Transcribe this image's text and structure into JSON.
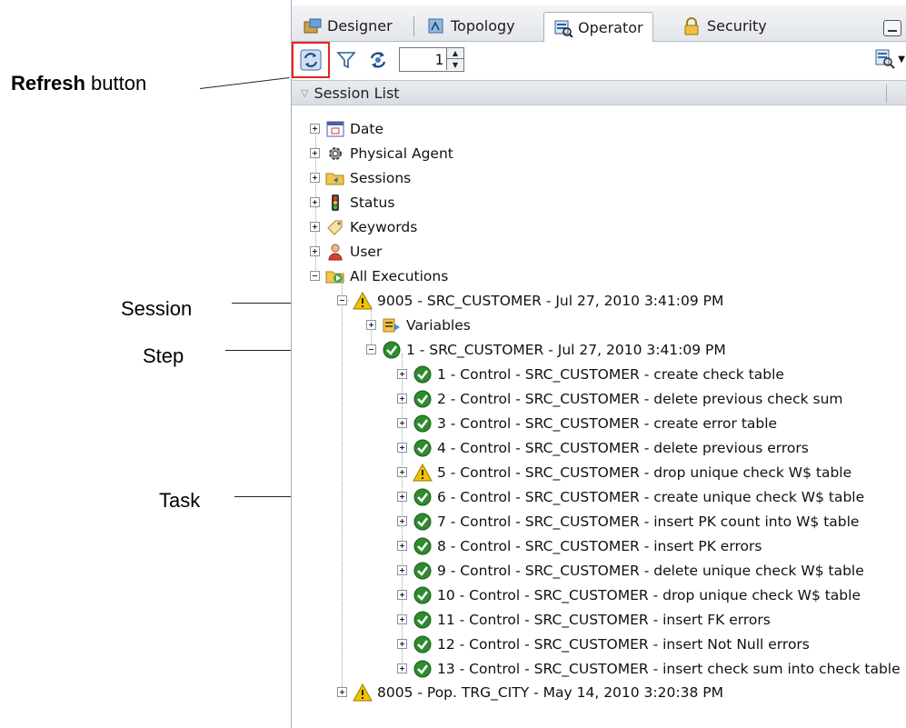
{
  "annotations": {
    "refresh_bold": "Refresh",
    "refresh_rest": " button",
    "session": "Session",
    "step": "Step",
    "task": "Task"
  },
  "tabs": [
    {
      "label": "Designer",
      "icon": "designer-icon"
    },
    {
      "label": "Topology",
      "icon": "topology-icon"
    },
    {
      "label": "Operator",
      "icon": "operator-icon",
      "active": true
    },
    {
      "label": "Security",
      "icon": "security-icon"
    }
  ],
  "toolbar": {
    "refresh": "refresh-icon",
    "filter": "filter-icon",
    "auto_refresh": "auto-refresh-icon",
    "spinner_value": "1"
  },
  "section": {
    "title": "Session List"
  },
  "tree": {
    "categories": [
      {
        "label": "Date",
        "icon": "calendar-icon"
      },
      {
        "label": "Physical Agent",
        "icon": "gear-icon"
      },
      {
        "label": "Sessions",
        "icon": "folder-icon"
      },
      {
        "label": "Status",
        "icon": "traffic-light-icon"
      },
      {
        "label": "Keywords",
        "icon": "tag-icon"
      },
      {
        "label": "User",
        "icon": "user-icon"
      },
      {
        "label": "All Executions",
        "icon": "executions-icon"
      }
    ],
    "session": {
      "label": "9005 - SRC_CUSTOMER - Jul 27, 2010 3:41:09 PM",
      "status": "warning"
    },
    "variables": {
      "label": "Variables"
    },
    "step": {
      "label": "1 - SRC_CUSTOMER - Jul 27, 2010 3:41:09 PM",
      "status": "success"
    },
    "tasks": [
      {
        "label": "1 - Control - SRC_CUSTOMER - create check table",
        "status": "success"
      },
      {
        "label": "2 - Control - SRC_CUSTOMER - delete previous check sum",
        "status": "success"
      },
      {
        "label": "3 - Control - SRC_CUSTOMER - create error table",
        "status": "success"
      },
      {
        "label": "4 - Control - SRC_CUSTOMER - delete previous errors",
        "status": "success"
      },
      {
        "label": "5 - Control - SRC_CUSTOMER - drop unique check W$ table",
        "status": "warning"
      },
      {
        "label": "6 - Control - SRC_CUSTOMER - create unique check W$ table",
        "status": "success"
      },
      {
        "label": "7 - Control - SRC_CUSTOMER - insert PK count into W$ table",
        "status": "success"
      },
      {
        "label": "8 - Control - SRC_CUSTOMER - insert PK errors",
        "status": "success"
      },
      {
        "label": "9 - Control - SRC_CUSTOMER - delete unique check W$ table",
        "status": "success"
      },
      {
        "label": "10 - Control - SRC_CUSTOMER - drop unique check W$ table",
        "status": "success"
      },
      {
        "label": "11 - Control - SRC_CUSTOMER - insert FK errors",
        "status": "success"
      },
      {
        "label": "12 - Control - SRC_CUSTOMER - insert Not Null errors",
        "status": "success"
      },
      {
        "label": "13 - Control - SRC_CUSTOMER - insert check sum into check table",
        "status": "success"
      }
    ],
    "other_session": {
      "label": "8005 - Pop. TRG_CITY - May 14, 2010 3:20:38 PM",
      "status": "warning"
    }
  },
  "colors": {
    "highlight": "#e8231f",
    "success": "#2e8b2e",
    "warning": "#f2c200"
  }
}
